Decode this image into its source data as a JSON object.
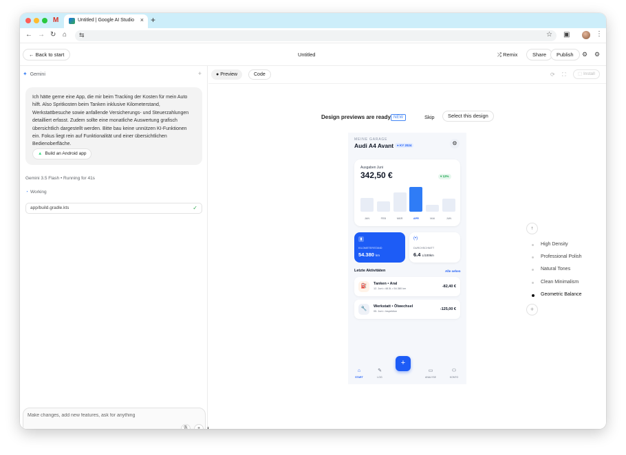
{
  "browser": {
    "tab_title": "Untitled | Google AI Studio",
    "new_tab": "+",
    "tab_close": "×"
  },
  "header": {
    "back_label": "Back to start",
    "title": "Untitled",
    "remix_label": "Remix",
    "share_label": "Share",
    "publish_label": "Publish"
  },
  "chat": {
    "assistant_label": "Gemini",
    "user_message": "Ich hätte gerne eine App, die mir beim Tracking der Kosten für mein Auto hilft. Also Spritkosten beim Tanken inklusive Kilometerstand, Werkstattbesuche sowie anfallende Versicherungs- und Steuerzahlungen detailliert erfasst. Zudem sollte eine monatliche Auswertung grafisch übersichtlich dargestellt werden. Bitte bau keine unnützen KI-Funktionen ein. Fokus liegt rein auf Funktionalität und einer übersichtlichen Bedienoberfläche.",
    "android_button": "Build an Android app",
    "model_name": "Gemini 3.5 Flash",
    "running_status": "Running for 41s",
    "working_label": "Working",
    "file_name": "app/build.gradle.kts",
    "prompt_placeholder": "Make changes, add new features, ask for anything"
  },
  "preview_toolbar": {
    "preview_tab": "Preview",
    "code_tab": "Code",
    "install_label": "Install"
  },
  "design": {
    "ready_title": "Design previews are ready",
    "new_badge": "NEW",
    "skip_label": "Skip",
    "select_label": "Select this design",
    "styles": [
      {
        "label": "High Density",
        "selected": false
      },
      {
        "label": "Professional Polish",
        "selected": false
      },
      {
        "label": "Natural Tones",
        "selected": false
      },
      {
        "label": "Clean Minimalism",
        "selected": false
      },
      {
        "label": "Geometric Balance",
        "selected": true
      }
    ]
  },
  "phone": {
    "subtitle": "MEINE GARAGE",
    "car_name": "Audi A4 Avant",
    "badge": "● KY 2024",
    "card_label": "Ausgaben Juni",
    "amount": "342,50 €",
    "trend": "▾ 12%",
    "chart_data": {
      "type": "bar",
      "categories": [
        "JAN",
        "FEB",
        "MÄR",
        "APR",
        "MAI",
        "JUN"
      ],
      "values": [
        0.55,
        0.42,
        0.78,
        1.0,
        0.28,
        0.52
      ],
      "highlight_index": 3
    },
    "km_label": "KILOMETERSTAND",
    "km_value": "54.380",
    "km_unit": "km",
    "avg_label": "DURCHSCHNITT",
    "avg_value": "6.4",
    "avg_unit": "L/100km",
    "activities_title": "Letzte Aktivitäten",
    "see_all": "Alle sehen",
    "activities": [
      {
        "title": "Tanken • Aral",
        "sub": "12. Juni • 48.3L • 54.380 km",
        "amount": "-82,40 €"
      },
      {
        "title": "Werkstatt • Ölwechsel",
        "sub": "05. Juni • Inspektion",
        "amount": "-125,00 €"
      }
    ],
    "nav": [
      {
        "label": "START"
      },
      {
        "label": "LOG"
      },
      {
        "label": "ANALYSE"
      },
      {
        "label": "KONTO"
      }
    ]
  },
  "colors": {
    "accent": "#1d5cf6",
    "tabstrip": "#cdeefa",
    "success": "#34a853"
  }
}
